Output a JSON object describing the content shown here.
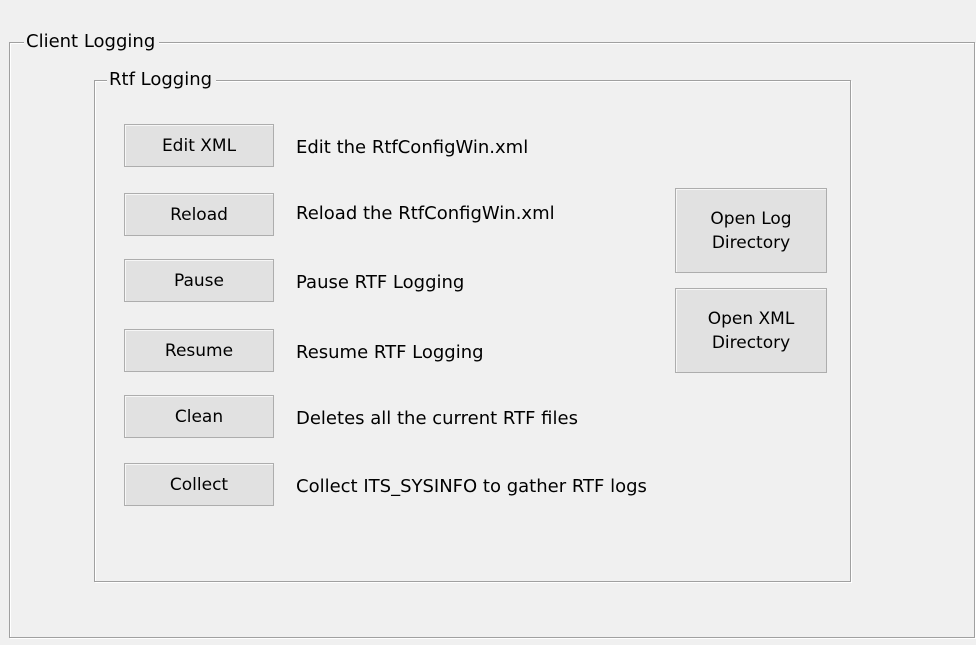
{
  "client_logging": {
    "title": "Client Logging",
    "rtf_logging": {
      "title": "Rtf Logging",
      "actions": [
        {
          "button": "Edit XML",
          "description": "Edit the RtfConfigWin.xml"
        },
        {
          "button": "Reload",
          "description": "Reload the RtfConfigWin.xml"
        },
        {
          "button": "Pause",
          "description": "Pause RTF Logging"
        },
        {
          "button": "Resume",
          "description": "Resume RTF Logging"
        },
        {
          "button": "Clean",
          "description": "Deletes all the current RTF files"
        },
        {
          "button": "Collect",
          "description": "Collect ITS_SYSINFO to gather RTF logs"
        }
      ],
      "open_log_directory": "Open Log\nDirectory",
      "open_xml_directory": "Open XML\nDirectory"
    }
  }
}
